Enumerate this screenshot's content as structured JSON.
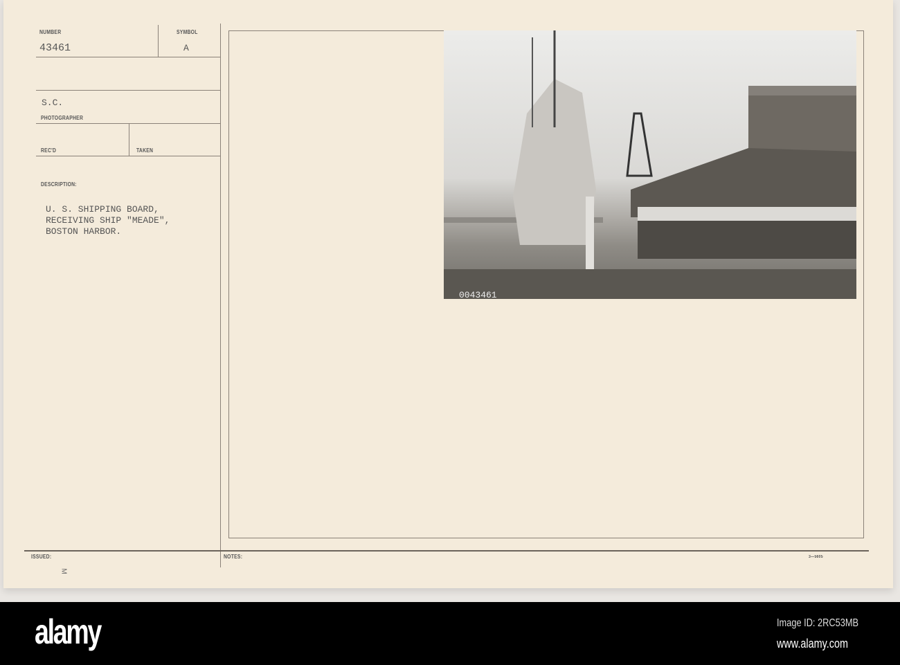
{
  "card": {
    "number_label": "NUMBER",
    "number": "43461",
    "symbol_label": "SYMBOL",
    "symbol": "A",
    "photographer": "S.C.",
    "photographer_label": "PHOTOGRAPHER",
    "recd_label": "REC'D",
    "taken_label": "TAKEN",
    "description_label": "DESCRIPTION:",
    "description": [
      "U. S. SHIPPING BOARD,",
      "RECEIVING SHIP \"MEADE\",",
      "BOSTON HARBOR."
    ],
    "issued_label": "ISSUED:",
    "notes_label": "NOTES:",
    "form_number": "3—5605",
    "margin_mark": "M",
    "photo_number": "0043461"
  },
  "footer": {
    "logo": "alamy",
    "image_id": "Image ID: 2RC53MB",
    "url": "www.alamy.com"
  }
}
